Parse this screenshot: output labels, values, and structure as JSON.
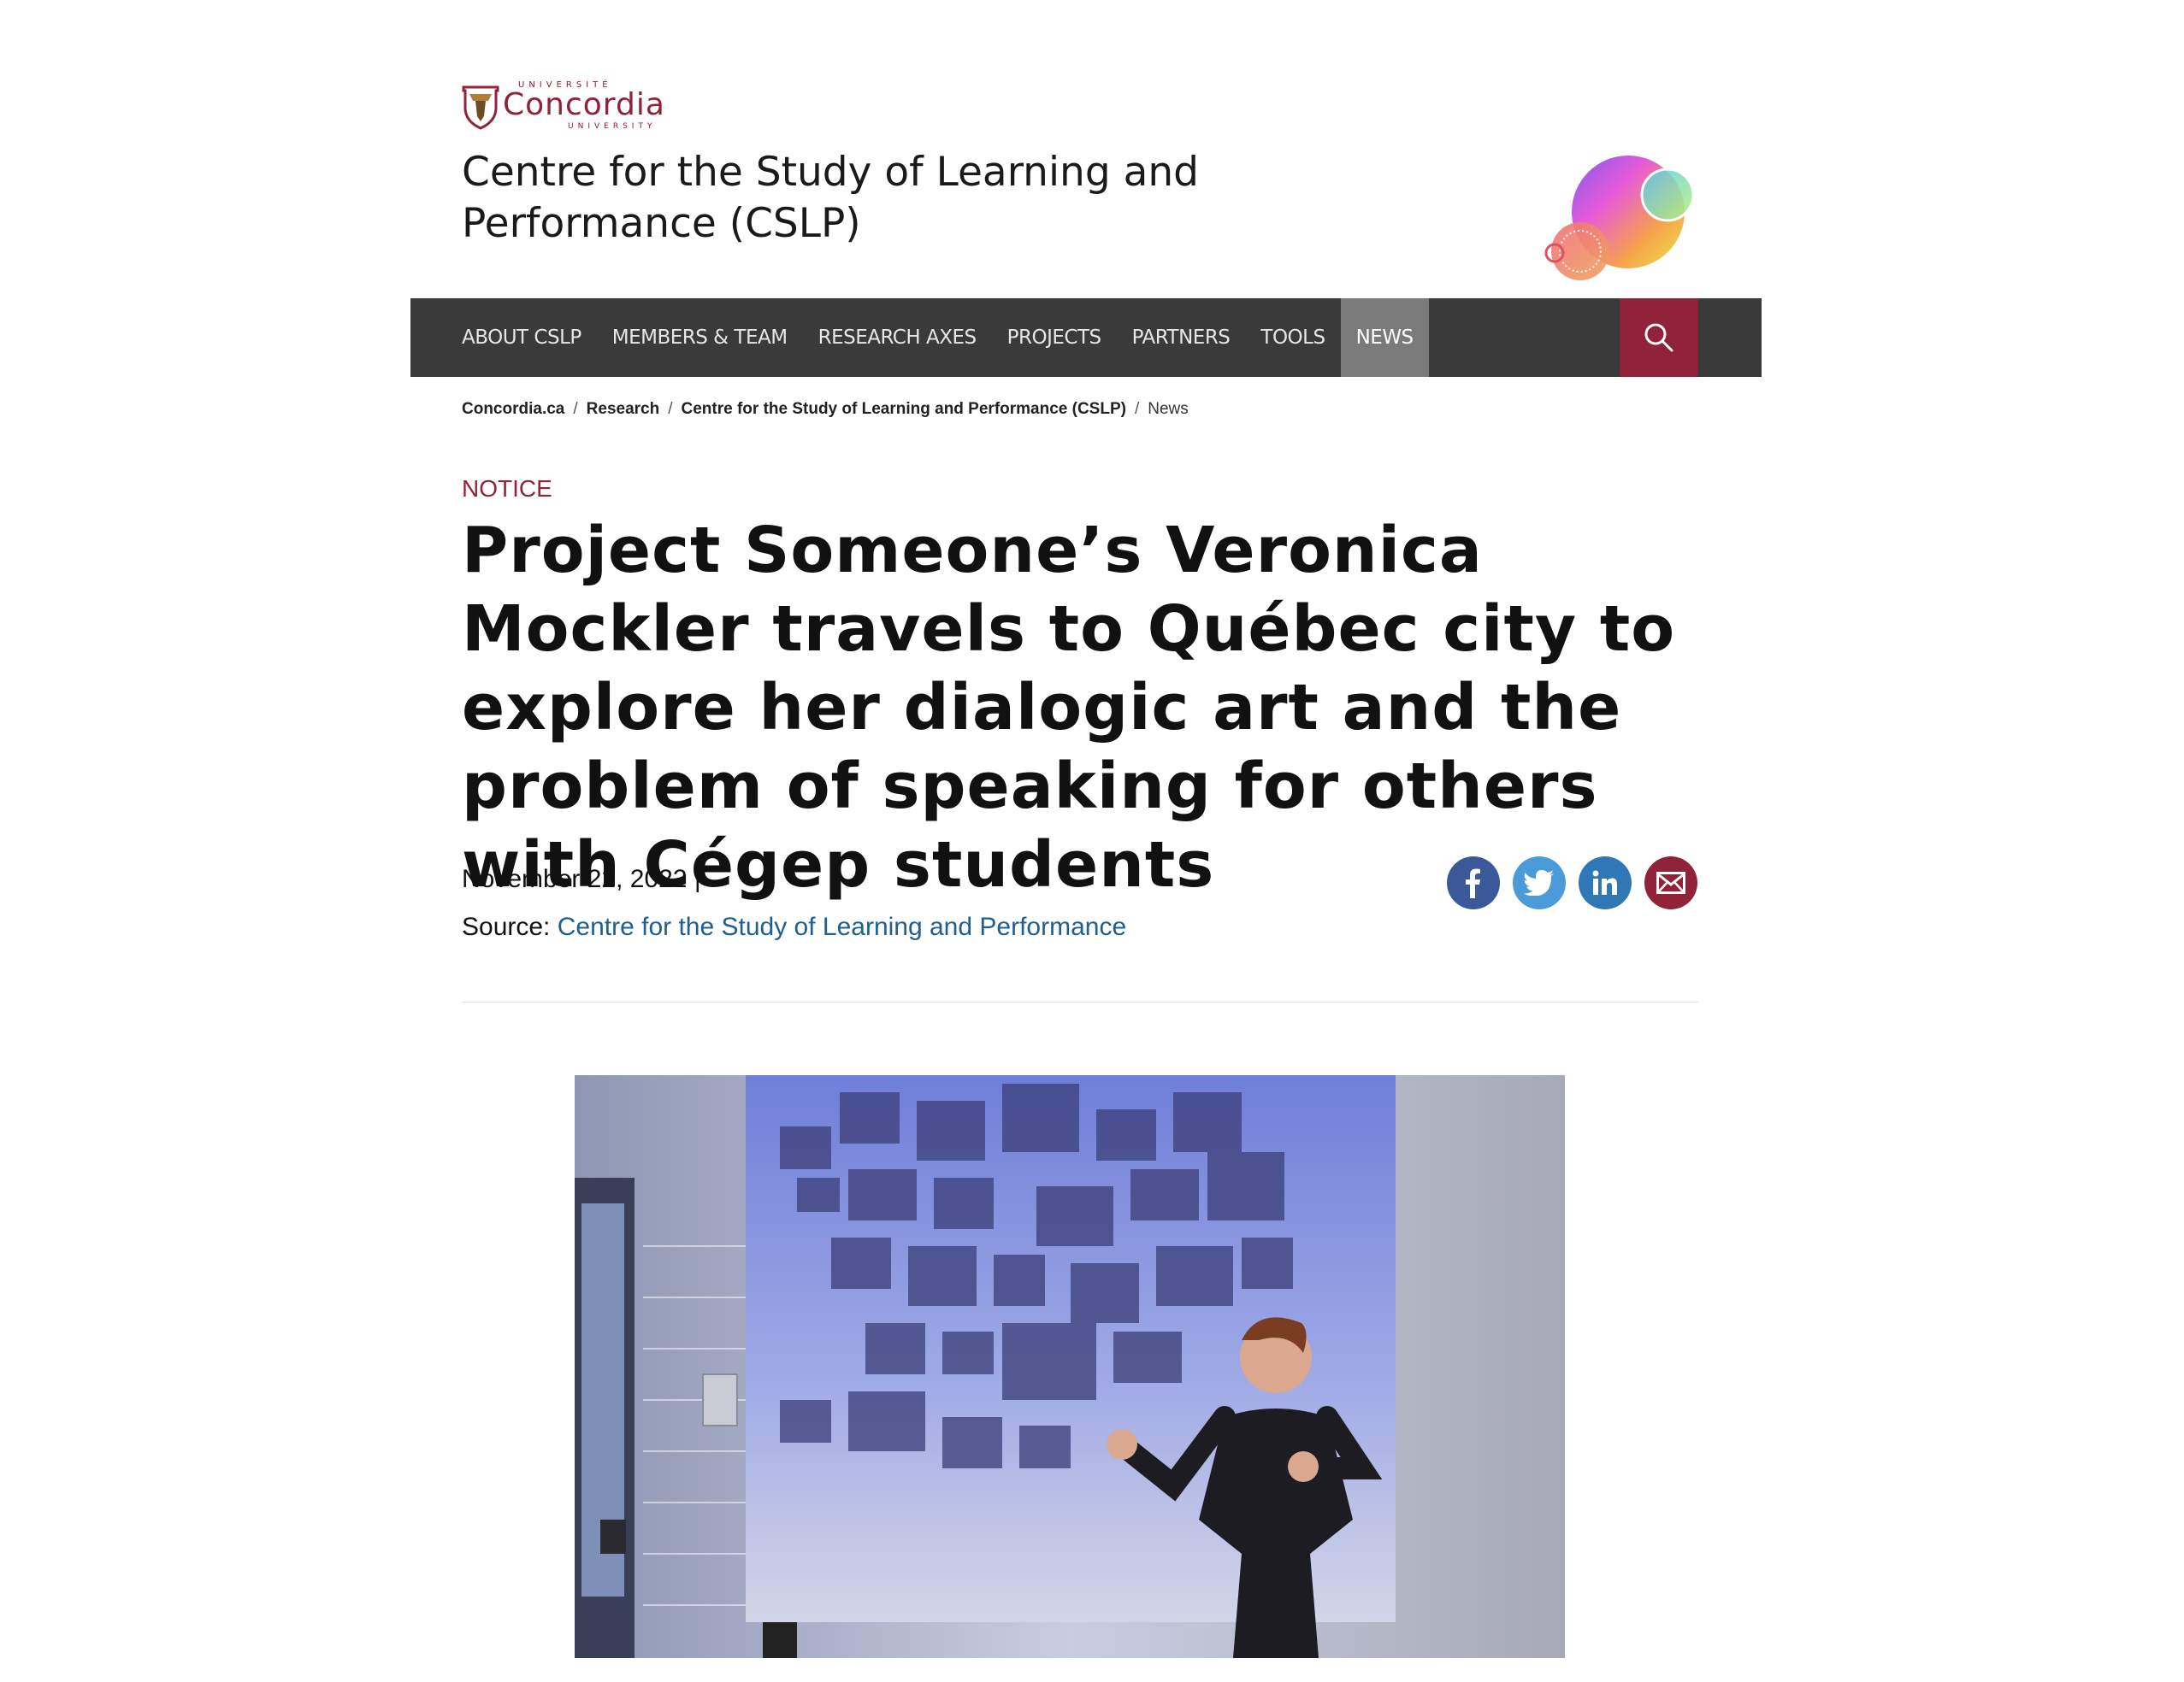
{
  "brand": {
    "logo_top": "UNIVERSITÉ",
    "logo_main": "Concordia",
    "logo_bottom": "UNIVERSITY",
    "primary_color": "#912338",
    "nav_color": "#3a3a3a",
    "link_color": "#1f5f8f"
  },
  "site": {
    "title": "Centre for the Study of Learning and Performance (CSLP)"
  },
  "nav": {
    "items": [
      {
        "label": "ABOUT CSLP"
      },
      {
        "label": "MEMBERS & TEAM"
      },
      {
        "label": "RESEARCH AXES"
      },
      {
        "label": "PROJECTS"
      },
      {
        "label": "PARTNERS"
      },
      {
        "label": "TOOLS"
      },
      {
        "label": "NEWS",
        "active": true
      }
    ],
    "search_icon": "search-icon"
  },
  "breadcrumb": {
    "items": [
      "Concordia.ca",
      "Research",
      "Centre for the Study of Learning and Performance (CSLP)"
    ],
    "separator": "/",
    "current": "News"
  },
  "article": {
    "kicker": "NOTICE",
    "headline": "Project Someone’s Veronica Mockler travels to Québec city to explore her dialogic art and the problem of speaking for others with Cégep students",
    "date": "November 22, 2022 |",
    "source_label": "Source: ",
    "source_link": "Centre for the Study of Learning and Performance"
  },
  "share": {
    "icons": [
      "facebook-icon",
      "twitter-icon",
      "linkedin-icon",
      "email-icon"
    ]
  }
}
